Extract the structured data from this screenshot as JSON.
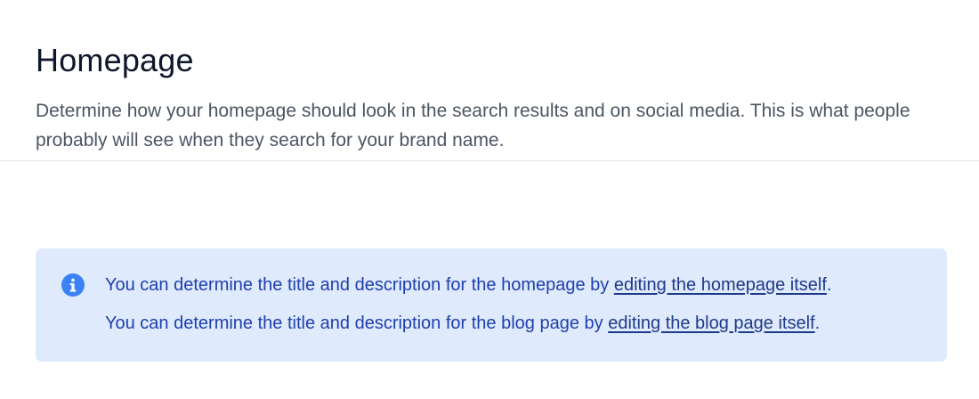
{
  "page": {
    "title": "Homepage",
    "description": "Determine how your homepage should look in the search results and on social media. This is what people probably will see when they search for your brand name."
  },
  "alert": {
    "icon": "info-icon",
    "line1": {
      "prefix": "You can determine the title and description for the homepage by ",
      "link": "editing the homepage itself",
      "suffix": "."
    },
    "line2": {
      "prefix": "You can determine the title and description for the blog page by ",
      "link": "editing the blog page itself",
      "suffix": "."
    }
  },
  "colors": {
    "alert_background": "#dfeafc",
    "alert_text": "#1e40af",
    "icon_blue": "#3b82f6",
    "title": "#0f172a",
    "description": "#4b5563"
  }
}
